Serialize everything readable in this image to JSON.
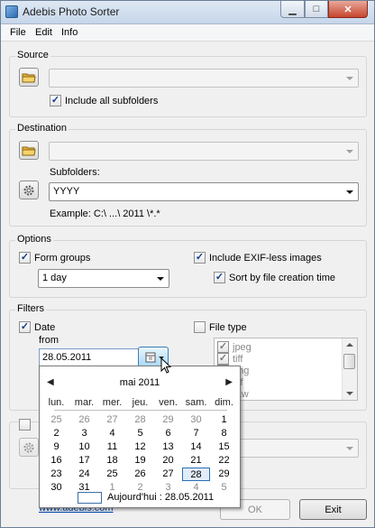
{
  "window": {
    "title": "Adebis Photo Sorter"
  },
  "menu": [
    "File",
    "Edit",
    "Info"
  ],
  "source": {
    "legend": "Source",
    "path_value": "",
    "include_subfolders_label": "Include all subfolders",
    "include_subfolders_checked": true
  },
  "destination": {
    "legend": "Destination",
    "path_value": "",
    "subfolders_label": "Subfolders:",
    "subfolders_value": "YYYY",
    "example": "Example: C:\\ ...\\ 2011 \\*.*"
  },
  "options": {
    "legend": "Options",
    "form_groups_label": "Form groups",
    "form_groups_checked": true,
    "group_period": "1 day",
    "exifless_label": "Include EXIF-less images",
    "exifless_checked": true,
    "sort_creation_label": "Sort by file creation time",
    "sort_creation_checked": true
  },
  "filters": {
    "legend": "Filters",
    "date_label": "Date",
    "date_checked": true,
    "from_label": "from",
    "from_value": "28.05.2011",
    "file_type_label": "File type",
    "file_type_checked": false,
    "file_types": [
      "jpeg",
      "tiff",
      "png",
      "gif",
      "raw"
    ]
  },
  "calendar": {
    "month_title": "mai 2011",
    "weekdays": [
      "lun.",
      "mar.",
      "mer.",
      "jeu.",
      "ven.",
      "sam.",
      "dim."
    ],
    "weeks": [
      [
        "25",
        "26",
        "27",
        "28",
        "29",
        "30",
        "1"
      ],
      [
        "2",
        "3",
        "4",
        "5",
        "6",
        "7",
        "8"
      ],
      [
        "9",
        "10",
        "11",
        "12",
        "13",
        "14",
        "15"
      ],
      [
        "16",
        "17",
        "18",
        "19",
        "20",
        "21",
        "22"
      ],
      [
        "23",
        "24",
        "25",
        "26",
        "27",
        "28",
        "29"
      ],
      [
        "30",
        "31",
        "1",
        "2",
        "3",
        "4",
        "5"
      ]
    ],
    "selected": "28",
    "today_label": "Aujourd'hui : 28.05.2011"
  },
  "footer": {
    "link": "www.adebis.com",
    "ok_label": "OK",
    "exit_label": "Exit"
  },
  "colors": {
    "accent": "#2c6eb5",
    "close": "#c7452e",
    "link": "#0645ad"
  }
}
